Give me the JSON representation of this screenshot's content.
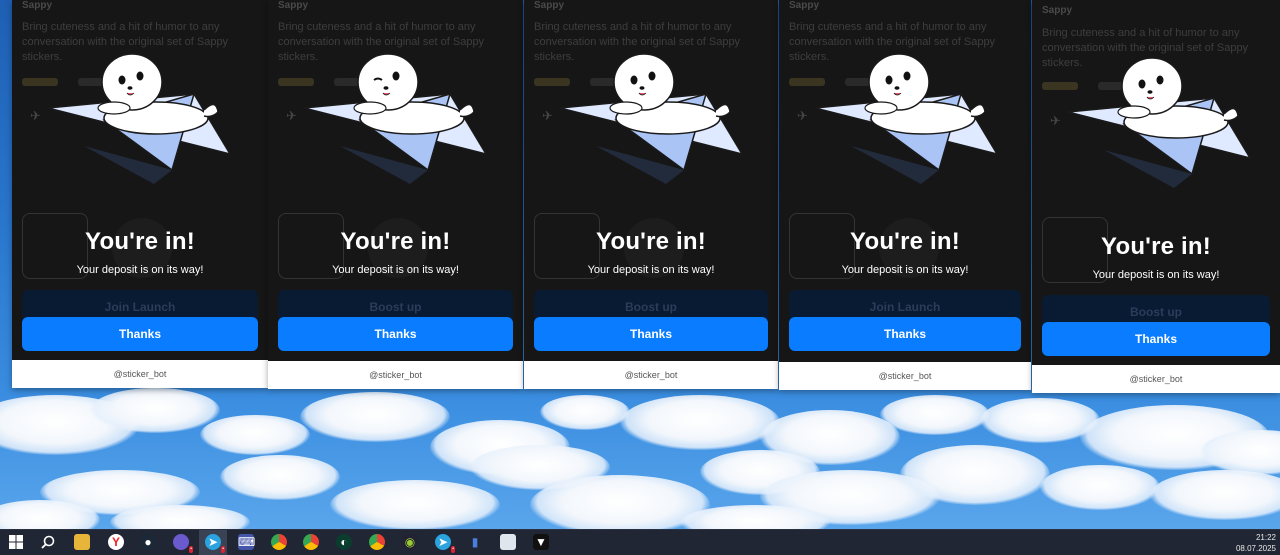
{
  "panels": [
    {
      "bg_channel_name": "Sappy",
      "bg_description": "Bring cuteness and a hit of humor to any conversation with the original set of Sappy stickers.",
      "bg_button_label": "Join Launch",
      "success_title": "You're in!",
      "success_subtitle": "Your deposit is on its way!",
      "thanks_label": "Thanks",
      "footer_handle": "@sticker_bot"
    },
    {
      "bg_channel_name": "Sappy",
      "bg_description": "Bring cuteness and a hit of humor to any conversation with the original set of Sappy stickers.",
      "bg_button_label": "Boost up",
      "success_title": "You're in!",
      "success_subtitle": "Your deposit is on its way!",
      "thanks_label": "Thanks",
      "footer_handle": "@sticker_bot"
    },
    {
      "bg_channel_name": "Sappy",
      "bg_description": "Bring cuteness and a hit of humor to any conversation with the original set of Sappy stickers.",
      "bg_button_label": "Boost up",
      "success_title": "You're in!",
      "success_subtitle": "Your deposit is on its way!",
      "thanks_label": "Thanks",
      "footer_handle": "@sticker_bot"
    },
    {
      "bg_channel_name": "Sappy",
      "bg_description": "Bring cuteness and a hit of humor to any conversation with the original set of Sappy stickers.",
      "bg_button_label": "Join Launch",
      "success_title": "You're in!",
      "success_subtitle": "Your deposit is on its way!",
      "thanks_label": "Thanks",
      "footer_handle": "@sticker_bot"
    },
    {
      "bg_channel_name": "Sappy",
      "bg_description": "Bring cuteness and a hit of humor to any conversation with the original set of Sappy stickers.",
      "bg_button_label": "Boost up",
      "success_title": "You're in!",
      "success_subtitle": "Your deposit is on its way!",
      "thanks_label": "Thanks",
      "footer_handle": "@sticker_bot"
    }
  ],
  "taskbar": {
    "icons": [
      "start-icon",
      "search-icon",
      "file-explorer-icon",
      "yandex-browser-icon",
      "steam-icon",
      "discord-icon",
      "telegram-icon",
      "keyboard-app-icon",
      "chrome-icon",
      "chrome-icon",
      "terminal-icon",
      "chrome-icon",
      "app-icon",
      "telegram-icon",
      "stats-icon",
      "window-icon",
      "vpn-icon"
    ],
    "time": "21:22",
    "date": "08.07.2025"
  },
  "colors": {
    "accent": "#0a7cff",
    "panel_bg": "#161616",
    "taskbar": "#202633"
  }
}
